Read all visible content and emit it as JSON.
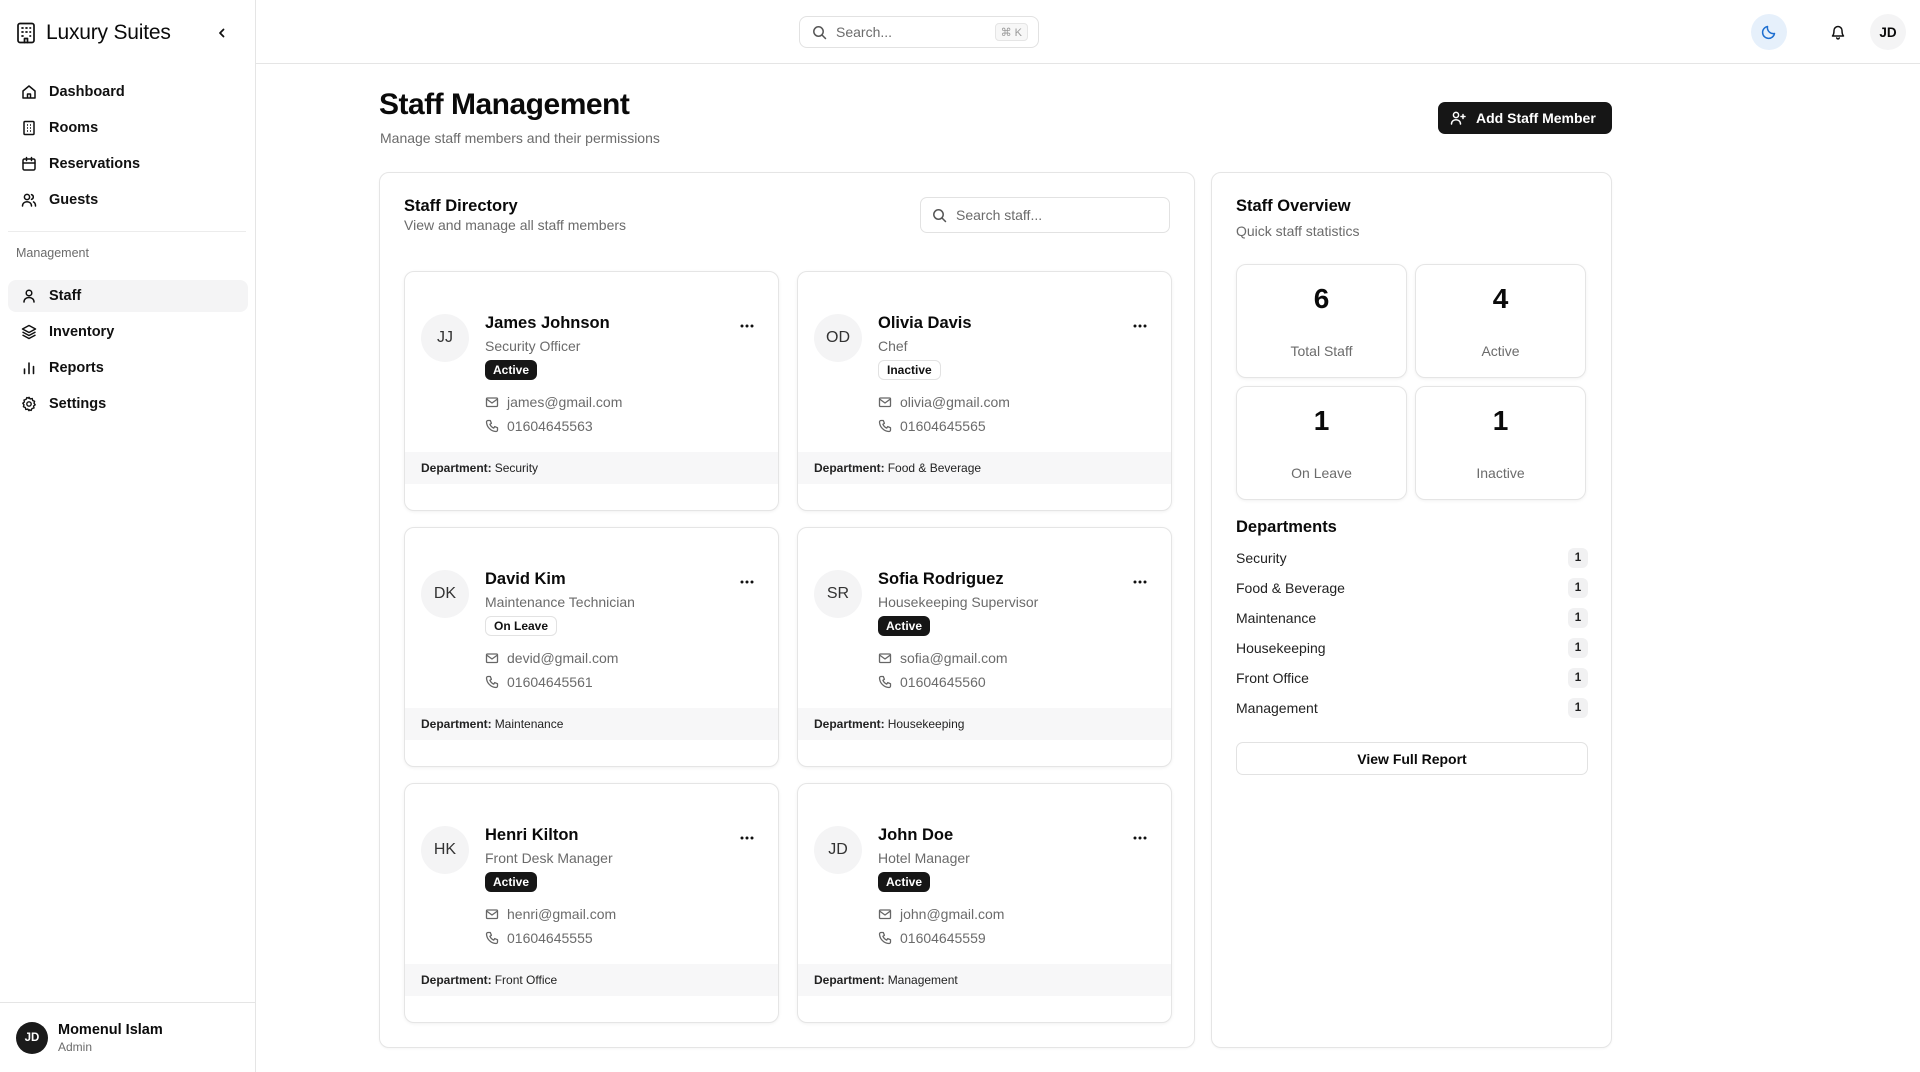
{
  "app": {
    "name": "Luxury Suites"
  },
  "nav": {
    "items": [
      {
        "label": "Dashboard"
      },
      {
        "label": "Rooms"
      },
      {
        "label": "Reservations"
      },
      {
        "label": "Guests"
      }
    ],
    "section_label": "Management",
    "management_items": [
      {
        "label": "Staff"
      },
      {
        "label": "Inventory"
      },
      {
        "label": "Reports"
      },
      {
        "label": "Settings"
      }
    ],
    "active_item": "Staff"
  },
  "user": {
    "initials": "JD",
    "name": "Momenul Islam",
    "role": "Admin"
  },
  "topbar": {
    "search_placeholder": "Search...",
    "shortcut": "⌘ K",
    "avatar_initials": "JD"
  },
  "page": {
    "title": "Staff Management",
    "subtitle": "Manage staff members and their permissions",
    "add_button": "Add Staff Member"
  },
  "directory": {
    "title": "Staff Directory",
    "subtitle": "View and manage all staff members",
    "search_placeholder": "Search staff...",
    "department_label": "Department:",
    "staff": [
      {
        "initials": "JJ",
        "name": "James Johnson",
        "role": "Security Officer",
        "status": "Active",
        "email": "james@gmail.com",
        "phone": "01604645563",
        "department": "Security"
      },
      {
        "initials": "OD",
        "name": "Olivia Davis",
        "role": "Chef",
        "status": "Inactive",
        "email": "olivia@gmail.com",
        "phone": "01604645565",
        "department": "Food & Beverage"
      },
      {
        "initials": "DK",
        "name": "David Kim",
        "role": "Maintenance Technician",
        "status": "On Leave",
        "email": "devid@gmail.com",
        "phone": "01604645561",
        "department": "Maintenance"
      },
      {
        "initials": "SR",
        "name": "Sofia Rodriguez",
        "role": "Housekeeping Supervisor",
        "status": "Active",
        "email": "sofia@gmail.com",
        "phone": "01604645560",
        "department": "Housekeeping"
      },
      {
        "initials": "HK",
        "name": "Henri Kilton",
        "role": "Front Desk Manager",
        "status": "Active",
        "email": "henri@gmail.com",
        "phone": "01604645555",
        "department": "Front Office"
      },
      {
        "initials": "JD",
        "name": "John Doe",
        "role": "Hotel Manager",
        "status": "Active",
        "email": "john@gmail.com",
        "phone": "01604645559",
        "department": "Management"
      }
    ]
  },
  "overview": {
    "title": "Staff Overview",
    "subtitle": "Quick staff statistics",
    "stats": [
      {
        "value": "6",
        "label": "Total Staff"
      },
      {
        "value": "4",
        "label": "Active"
      },
      {
        "value": "1",
        "label": "On Leave"
      },
      {
        "value": "1",
        "label": "Inactive"
      }
    ],
    "departments_title": "Departments",
    "departments": [
      {
        "name": "Security",
        "count": "1"
      },
      {
        "name": "Food & Beverage",
        "count": "1"
      },
      {
        "name": "Maintenance",
        "count": "1"
      },
      {
        "name": "Housekeeping",
        "count": "1"
      },
      {
        "name": "Front Office",
        "count": "1"
      },
      {
        "name": "Management",
        "count": "1"
      }
    ],
    "report_button": "View Full Report"
  },
  "colors": {
    "primary": "#161616",
    "muted_text": "#6b6b6b",
    "border": "#e5e5e5",
    "theme_toggle_bg": "#e6f0fb",
    "theme_toggle_icon": "#1f6fd0"
  },
  "icons": [
    "building-icon",
    "chevron-left-icon",
    "home-icon",
    "door-icon",
    "calendar-icon",
    "users-icon",
    "user-icon",
    "layers-icon",
    "bar-chart-icon",
    "gear-icon",
    "search-icon",
    "moon-icon",
    "bell-icon",
    "user-plus-icon",
    "ellipsis-icon",
    "mail-icon",
    "phone-icon"
  ]
}
